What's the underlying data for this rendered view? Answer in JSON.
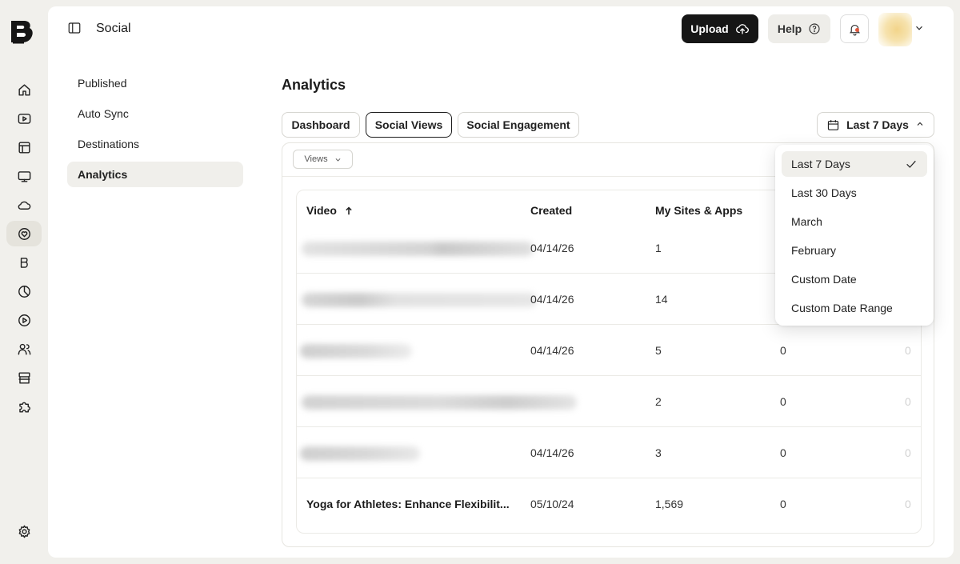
{
  "app": {
    "section_title": "Social",
    "logo_letter": "B"
  },
  "header": {
    "upload_label": "Upload",
    "help_label": "Help"
  },
  "rail": [
    {
      "icon": "home-icon"
    },
    {
      "icon": "video-play-icon"
    },
    {
      "icon": "layout-grid-icon"
    },
    {
      "icon": "tv-icon"
    },
    {
      "icon": "cloud-icon"
    },
    {
      "icon": "heart-social-icon",
      "active": true
    },
    {
      "icon": "brand-icon"
    },
    {
      "icon": "pie-chart-icon"
    },
    {
      "icon": "play-circle-icon"
    },
    {
      "icon": "users-icon"
    },
    {
      "icon": "store-icon"
    },
    {
      "icon": "puzzle-icon"
    }
  ],
  "subnav": [
    {
      "label": "Published"
    },
    {
      "label": "Auto Sync"
    },
    {
      "label": "Destinations"
    },
    {
      "label": "Analytics",
      "active": true
    }
  ],
  "page": {
    "title": "Analytics",
    "tabs": [
      {
        "label": "Dashboard"
      },
      {
        "label": "Social Views",
        "active": true
      },
      {
        "label": "Social Engagement"
      }
    ],
    "date_filter_label": "Last 7 Days",
    "views_select_label": "Views"
  },
  "table": {
    "columns": [
      "Video",
      "Created",
      "My Sites & Apps"
    ],
    "rows": [
      {
        "video": "",
        "created": "04/14/26",
        "sites": "1",
        "col4": "",
        "col5": ""
      },
      {
        "video": "",
        "created": "04/14/26",
        "sites": "14",
        "col4": "",
        "col5": ""
      },
      {
        "video": "",
        "created": "04/14/26",
        "sites": "5",
        "col4": "0",
        "col5": "0"
      },
      {
        "video": "",
        "created": "",
        "sites": "2",
        "col4": "0",
        "col5": "0"
      },
      {
        "video": "",
        "created": "04/14/26",
        "sites": "3",
        "col4": "0",
        "col5": "0"
      },
      {
        "video": "Yoga for Athletes: Enhance Flexibilit...",
        "created": "05/10/24",
        "sites": "1,569",
        "col4": "0",
        "col5": "0"
      }
    ]
  },
  "date_dropdown": {
    "options": [
      {
        "label": "Last 7 Days",
        "selected": true
      },
      {
        "label": "Last 30 Days"
      },
      {
        "label": "March"
      },
      {
        "label": "February"
      },
      {
        "label": "Custom Date"
      },
      {
        "label": "Custom Date Range"
      }
    ]
  }
}
